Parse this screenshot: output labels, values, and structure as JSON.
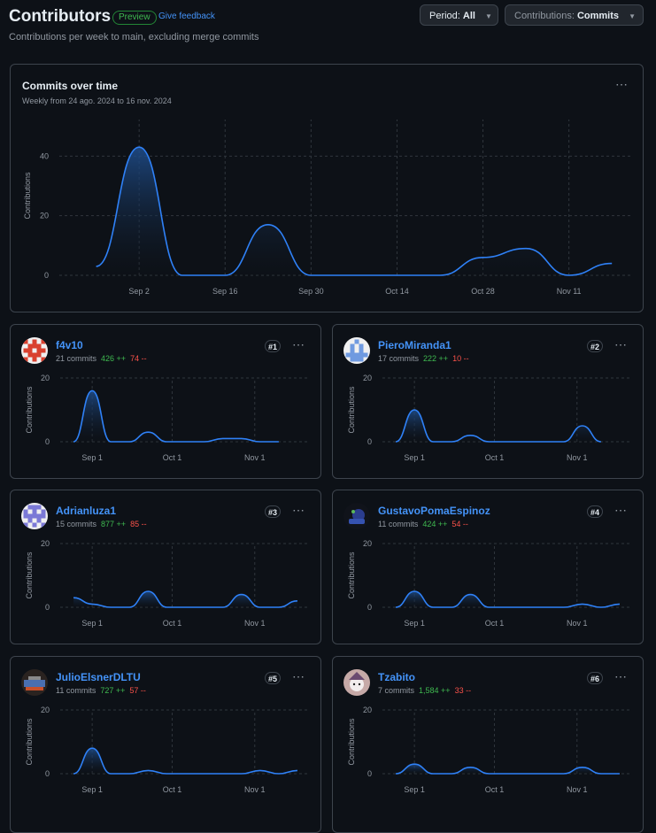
{
  "header": {
    "title": "Contributors",
    "preview_badge": "Preview",
    "feedback_link": "Give feedback",
    "subtitle": "Contributions per week to main, excluding merge commits",
    "period_label": "Period:",
    "period_value": "All",
    "contrib_label": "Contributions:",
    "contrib_value": "Commits"
  },
  "colors": {
    "background": "#0d1117",
    "line": "#2f81f7",
    "link": "#4493f8",
    "additions": "#3fb950",
    "deletions": "#f85149"
  },
  "main_chart": {
    "title": "Commits over time",
    "subtitle": "Weekly from 24 ago. 2024 to 16 nov. 2024",
    "ylabel": "Contributions",
    "yticks": [
      "0",
      "20",
      "40"
    ],
    "xticks": [
      "Sep 2",
      "Sep 16",
      "Sep 30",
      "Oct 14",
      "Oct 28",
      "Nov 11"
    ]
  },
  "contributors": [
    {
      "rank": "#1",
      "name": "f4v10",
      "commits": "21 commits",
      "additions": "426 ++",
      "deletions": "74 --",
      "avatar": "identicon-red"
    },
    {
      "rank": "#2",
      "name": "PieroMiranda1",
      "commits": "17 commits",
      "additions": "222 ++",
      "deletions": "10 --",
      "avatar": "identicon-blue"
    },
    {
      "rank": "#3",
      "name": "Adrianluza1",
      "commits": "15 commits",
      "additions": "877 ++",
      "deletions": "85 --",
      "avatar": "identicon-purple"
    },
    {
      "rank": "#4",
      "name": "GustavoPomaEspinoz",
      "commits": "11 commits",
      "additions": "424 ++",
      "deletions": "54 --",
      "avatar": "photo-avatar"
    },
    {
      "rank": "#5",
      "name": "JulioElsnerDLTU",
      "commits": "11 commits",
      "additions": "727 ++",
      "deletions": "57 --",
      "avatar": "photo-avatar"
    },
    {
      "rank": "#6",
      "name": "Tzabito",
      "commits": "7 commits",
      "additions": "1,584 ++",
      "deletions": "33 --",
      "avatar": "photo-avatar"
    }
  ],
  "mini_chart": {
    "ylabel": "Contributions",
    "yticks": [
      "0",
      "20"
    ],
    "xticks": [
      "Sep 1",
      "Oct 1",
      "Nov 1"
    ]
  },
  "chart_data": [
    {
      "type": "area",
      "title": "Commits over time",
      "ylabel": "Contributions",
      "x": [
        "2024-08-26",
        "2024-09-02",
        "2024-09-09",
        "2024-09-16",
        "2024-09-23",
        "2024-09-30",
        "2024-10-07",
        "2024-10-14",
        "2024-10-21",
        "2024-10-28",
        "2024-11-04",
        "2024-11-11",
        "2024-11-18"
      ],
      "values": [
        3,
        43,
        0,
        0,
        17,
        0,
        0,
        0,
        0,
        6,
        9,
        0,
        4
      ],
      "ylim": [
        0,
        48
      ],
      "grid": true
    },
    {
      "type": "area",
      "series": [
        {
          "name": "f4v10",
          "values": [
            0,
            16,
            0,
            0,
            3,
            0,
            0,
            0,
            1,
            1,
            0,
            0
          ]
        }
      ],
      "x": [
        "2024-08-25",
        "2024-09-01",
        "2024-09-08",
        "2024-09-15",
        "2024-09-22",
        "2024-09-29",
        "2024-10-06",
        "2024-10-13",
        "2024-10-20",
        "2024-10-27",
        "2024-11-03",
        "2024-11-10"
      ],
      "ylim": [
        0,
        20
      ]
    },
    {
      "type": "area",
      "series": [
        {
          "name": "PieroMiranda1",
          "values": [
            0,
            10,
            0,
            0,
            2,
            0,
            0,
            0,
            0,
            0,
            5,
            0
          ]
        }
      ],
      "x": [
        "2024-08-25",
        "2024-09-01",
        "2024-09-08",
        "2024-09-15",
        "2024-09-22",
        "2024-09-29",
        "2024-10-06",
        "2024-10-13",
        "2024-10-20",
        "2024-10-27",
        "2024-11-03",
        "2024-11-10"
      ],
      "ylim": [
        0,
        20
      ]
    },
    {
      "type": "area",
      "series": [
        {
          "name": "Adrianluza1",
          "values": [
            3,
            1,
            0,
            0,
            5,
            0,
            0,
            0,
            0,
            4,
            0,
            0,
            2
          ]
        }
      ],
      "x": [
        "2024-08-25",
        "2024-09-01",
        "2024-09-08",
        "2024-09-15",
        "2024-09-22",
        "2024-09-29",
        "2024-10-06",
        "2024-10-13",
        "2024-10-20",
        "2024-10-27",
        "2024-11-03",
        "2024-11-10",
        "2024-11-17"
      ],
      "ylim": [
        0,
        20
      ]
    },
    {
      "type": "area",
      "series": [
        {
          "name": "GustavoPomaEspinoz",
          "values": [
            0,
            5,
            0,
            0,
            4,
            0,
            0,
            0,
            0,
            0,
            1,
            0,
            1
          ]
        }
      ],
      "x": [
        "2024-08-25",
        "2024-09-01",
        "2024-09-08",
        "2024-09-15",
        "2024-09-22",
        "2024-09-29",
        "2024-10-06",
        "2024-10-13",
        "2024-10-20",
        "2024-10-27",
        "2024-11-03",
        "2024-11-10",
        "2024-11-17"
      ],
      "ylim": [
        0,
        20
      ]
    },
    {
      "type": "area",
      "series": [
        {
          "name": "JulioElsnerDLTU",
          "values": [
            0,
            8,
            0,
            0,
            1,
            0,
            0,
            0,
            0,
            0,
            1,
            0,
            1
          ]
        }
      ],
      "x": [
        "2024-08-25",
        "2024-09-01",
        "2024-09-08",
        "2024-09-15",
        "2024-09-22",
        "2024-09-29",
        "2024-10-06",
        "2024-10-13",
        "2024-10-20",
        "2024-10-27",
        "2024-11-03",
        "2024-11-10",
        "2024-11-17"
      ],
      "ylim": [
        0,
        20
      ]
    },
    {
      "type": "area",
      "series": [
        {
          "name": "Tzabito",
          "values": [
            0,
            3,
            0,
            0,
            2,
            0,
            0,
            0,
            0,
            0,
            2,
            0,
            0
          ]
        }
      ],
      "x": [
        "2024-08-25",
        "2024-09-01",
        "2024-09-08",
        "2024-09-15",
        "2024-09-22",
        "2024-09-29",
        "2024-10-06",
        "2024-10-13",
        "2024-10-20",
        "2024-10-27",
        "2024-11-03",
        "2024-11-10",
        "2024-11-17"
      ],
      "ylim": [
        0,
        20
      ]
    }
  ]
}
